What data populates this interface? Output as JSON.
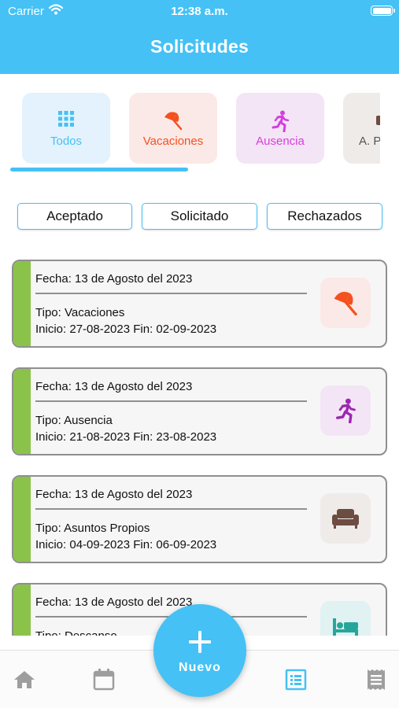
{
  "status_bar": {
    "carrier": "Carrier",
    "time": "12:38 a.m."
  },
  "app_bar": {
    "title": "Solicitudes"
  },
  "categories": [
    {
      "label": "Todos",
      "icon": "grid-icon",
      "bg": "#e3f2fd",
      "fg": "#45c1f5",
      "selected": true
    },
    {
      "label": "Vacaciones",
      "icon": "beach-umbrella-icon",
      "bg": "#fbe9e7",
      "fg": "#f4511e"
    },
    {
      "label": "Ausencia",
      "icon": "running-person-icon",
      "bg": "#f3e5f5",
      "fg": "#d63de0"
    },
    {
      "label": "A. P",
      "icon": "briefcase-icon",
      "bg": "#efebe9",
      "fg": "#555555"
    }
  ],
  "filters": {
    "accepted": "Aceptado",
    "requested": "Solicitado",
    "rejected": "Rechazados"
  },
  "requests": [
    {
      "date": "Fecha: 13 de Agosto del 2023",
      "type": "Tipo: Vacaciones",
      "range": "Inicio: 27-08-2023 Fin: 02-09-2023",
      "icon": "beach-umbrella-icon",
      "status_color": "#8bc34a"
    },
    {
      "date": "Fecha: 13 de Agosto del 2023",
      "type": "Tipo: Ausencia",
      "range": "Inicio: 21-08-2023 Fin: 23-08-2023",
      "icon": "running-person-icon",
      "status_color": "#8bc34a"
    },
    {
      "date": "Fecha: 13 de Agosto del 2023",
      "type": "Tipo: Asuntos Propios",
      "range": "Inicio: 04-09-2023 Fin: 06-09-2023",
      "icon": "sofa-icon",
      "status_color": "#8bc34a"
    },
    {
      "date": "Fecha: 13 de Agosto del 2023",
      "type": "Tipo: Descanso",
      "range": "",
      "icon": "bed-icon",
      "status_color": "#8bc34a"
    }
  ],
  "fab": {
    "label": "Nuevo"
  },
  "bottom_nav": [
    {
      "icon": "home-icon"
    },
    {
      "icon": "calendar-icon"
    },
    {
      "icon": "list-icon",
      "active": true
    },
    {
      "icon": "receipt-icon"
    }
  ],
  "colors": {
    "primary": "#45c1f5",
    "accepted_bar": "#8bc34a",
    "inactive_nav": "#9e9e9e"
  }
}
